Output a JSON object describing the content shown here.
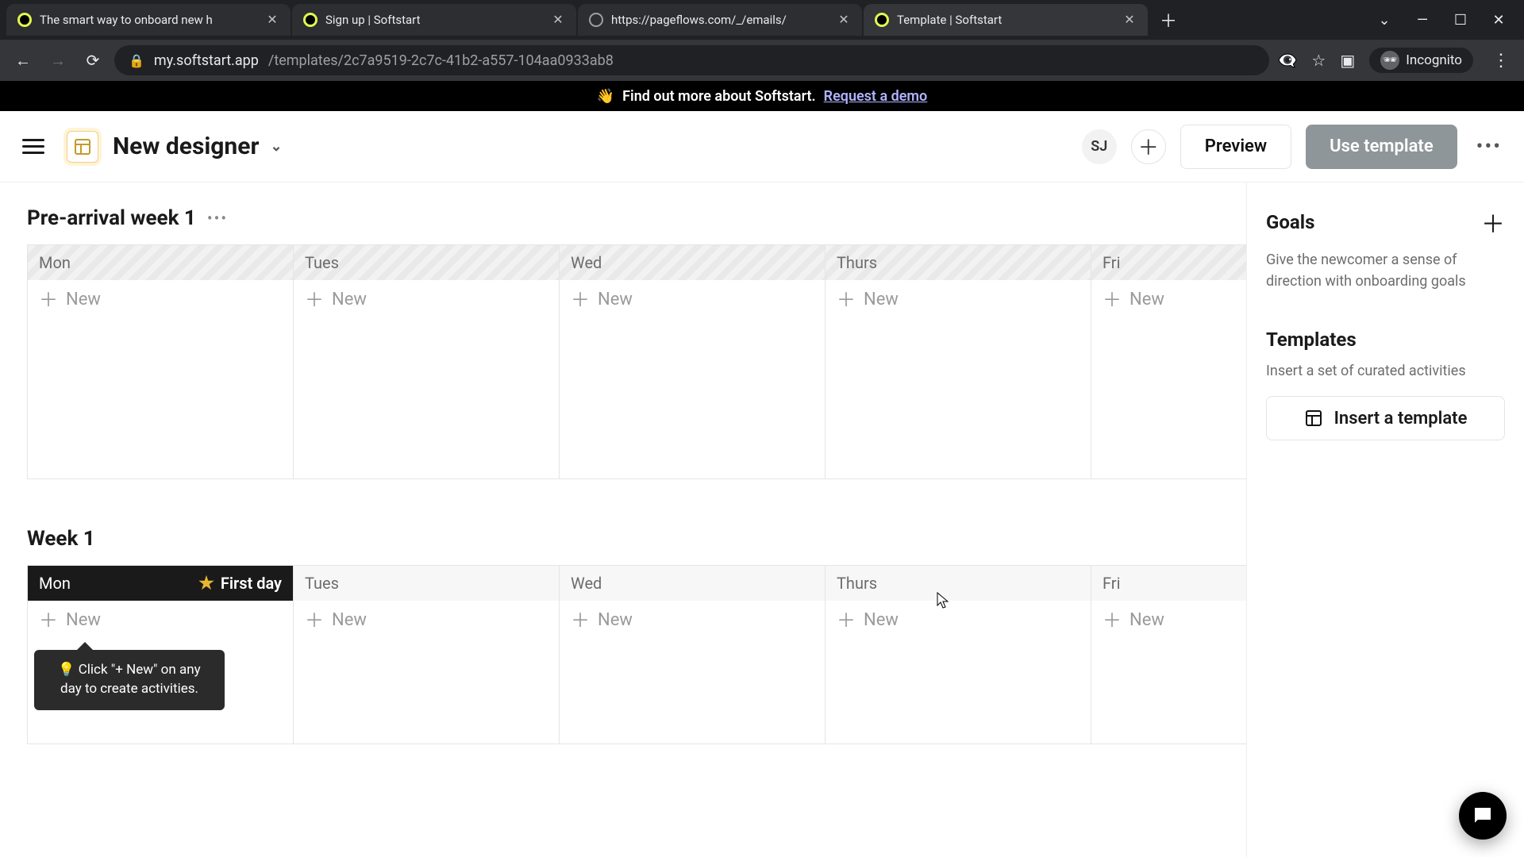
{
  "browser": {
    "tabs": [
      {
        "title": "The smart way to onboard new h",
        "favicon": "ring"
      },
      {
        "title": "Sign up | Softstart",
        "favicon": "ring"
      },
      {
        "title": "https://pageflows.com/_/emails/",
        "favicon": "globe"
      },
      {
        "title": "Template | Softstart",
        "favicon": "ring",
        "active": true
      }
    ],
    "url_host": "my.softstart.app",
    "url_path": "/templates/2c7a9519-2c7c-41b2-a557-104aa0933ab8",
    "incognito_label": "Incognito"
  },
  "promo": {
    "emoji": "👋",
    "text": "Find out more about Softstart.",
    "link_label": "Request a demo"
  },
  "header": {
    "doc_title": "New designer",
    "avatar": "SJ",
    "preview_label": "Preview",
    "use_template_label": "Use template"
  },
  "weeks": [
    {
      "title": "Pre-arrival week 1",
      "show_menu": true,
      "head_style": "disabled",
      "days": [
        {
          "label": "Mon",
          "new_label": "New"
        },
        {
          "label": "Tues",
          "new_label": "New"
        },
        {
          "label": "Wed",
          "new_label": "New"
        },
        {
          "label": "Thurs",
          "new_label": "New"
        },
        {
          "label": "Fri",
          "new_label": "New"
        }
      ]
    },
    {
      "title": "Week 1",
      "show_menu": false,
      "head_style": "plain",
      "days": [
        {
          "label": "Mon",
          "new_label": "New",
          "first_day": true,
          "first_day_label": "First day",
          "tip": "💡 Click \"+ New\" on any day to create activities."
        },
        {
          "label": "Tues",
          "new_label": "New"
        },
        {
          "label": "Wed",
          "new_label": "New"
        },
        {
          "label": "Thurs",
          "new_label": "New"
        },
        {
          "label": "Fri",
          "new_label": "New"
        }
      ]
    }
  ],
  "sidebar": {
    "goals": {
      "title": "Goals",
      "desc": "Give the newcomer a sense of direction with onboarding goals"
    },
    "templates": {
      "title": "Templates",
      "desc": "Insert a set of curated activities",
      "button_label": "Insert a template"
    }
  }
}
